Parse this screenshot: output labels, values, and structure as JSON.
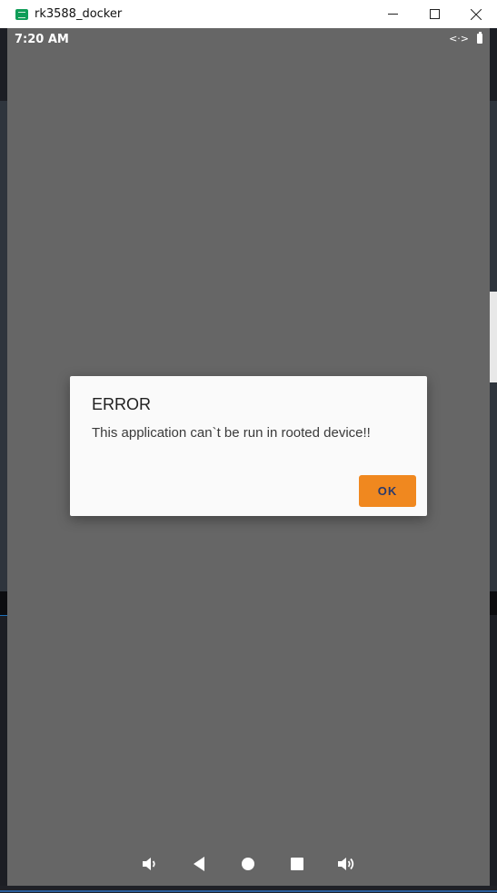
{
  "window": {
    "title": "rk3588_docker",
    "controls": {
      "minimize": "—",
      "maximize": "☐",
      "close": "✕"
    }
  },
  "statusbar": {
    "time": "7:20 AM",
    "icons": [
      "data-transfer-icon",
      "battery-icon"
    ],
    "transfer_glyph": "<·>"
  },
  "dialog": {
    "title": "ERROR",
    "message": "This application can`t be run in rooted device!!",
    "ok_label": "OK",
    "button_color": "#f0881f"
  },
  "navbar": {
    "items": [
      "volume-down-icon",
      "back-icon",
      "home-icon",
      "recents-icon",
      "volume-up-icon"
    ]
  },
  "colors": {
    "screen_background": "#666666",
    "dialog_background": "#fafafa"
  }
}
